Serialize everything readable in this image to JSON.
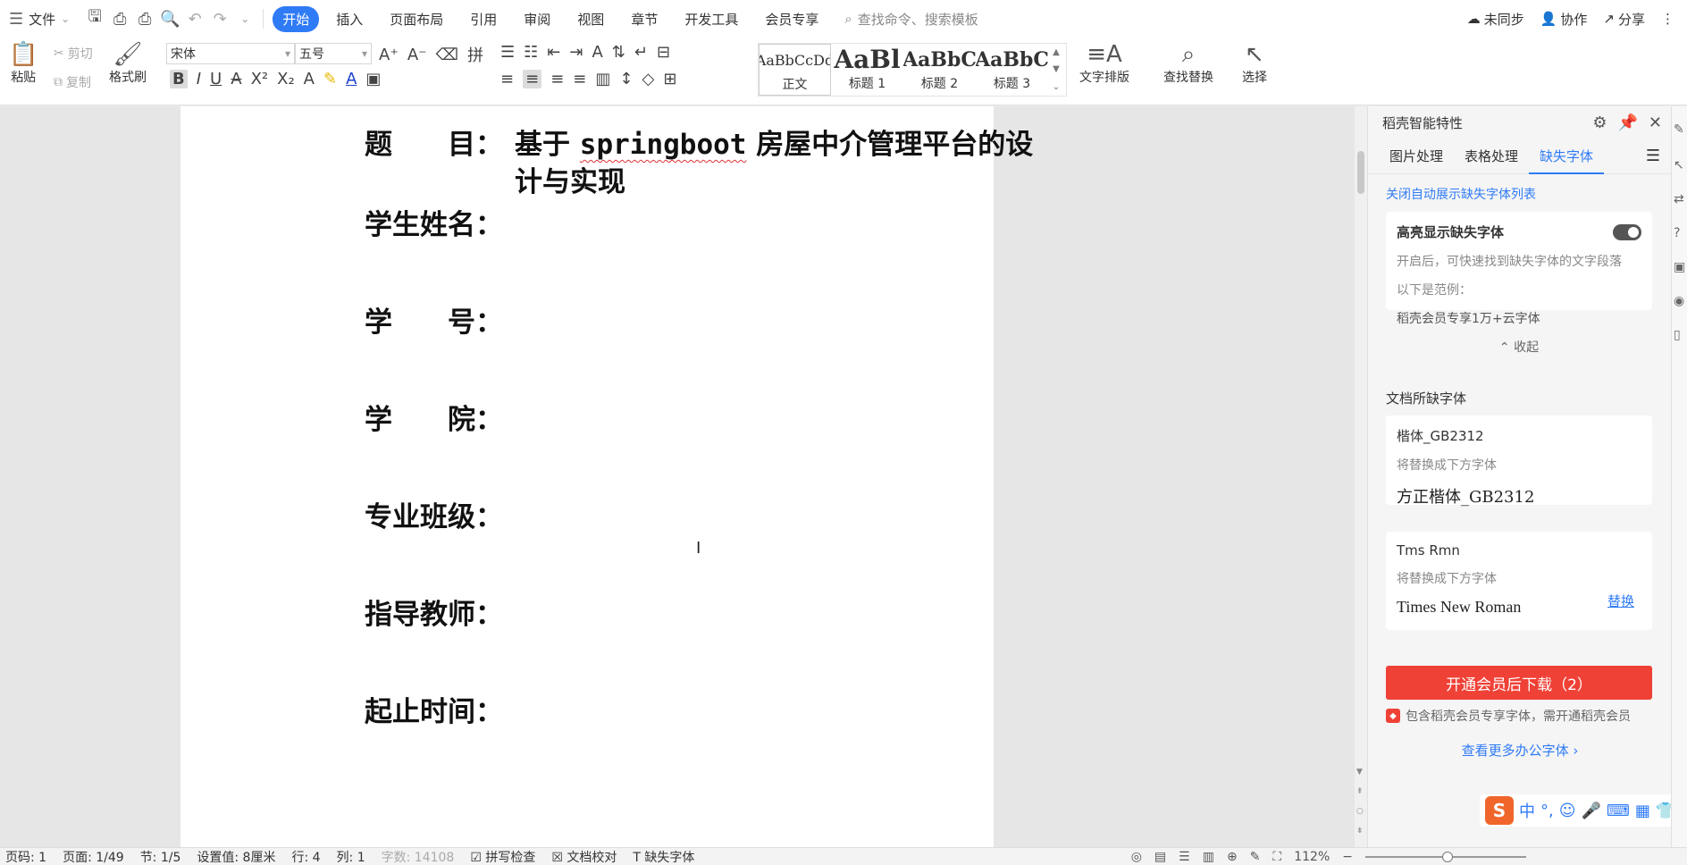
{
  "menubar": {
    "file_label": "文件",
    "tabs": [
      {
        "label": "开始",
        "active": true
      },
      {
        "label": "插入"
      },
      {
        "label": "页面布局"
      },
      {
        "label": "引用"
      },
      {
        "label": "审阅"
      },
      {
        "label": "视图"
      },
      {
        "label": "章节"
      },
      {
        "label": "开发工具"
      },
      {
        "label": "会员专享"
      }
    ],
    "search_placeholder": "查找命令、搜索模板",
    "right": {
      "sync": "未同步",
      "collab": "协作",
      "share": "分享"
    }
  },
  "ribbon": {
    "paste": "粘贴",
    "cut": "剪切",
    "copy": "复制",
    "format_painter": "格式刷",
    "font_family": "宋体",
    "font_size": "五号",
    "styles": [
      {
        "sample": "AaBbCcDd",
        "label": "正文"
      },
      {
        "sample": "AaBl",
        "label": "标题 1"
      },
      {
        "sample": "AaBbC",
        "label": "标题 2"
      },
      {
        "sample": "AaBbC",
        "label": "标题 3"
      }
    ],
    "text_layout": "文字排版",
    "find_replace": "查找替换",
    "select": "选择"
  },
  "document": {
    "title_label": "题　　目：",
    "title_prefix": "基于 ",
    "title_latin": "springboot",
    "title_rest": " 房屋中介管理平台的设计与实现",
    "fields": [
      "学生姓名：",
      "学　　号：",
      "学　　院：",
      "专业班级：",
      "指导教师：",
      "起止时间："
    ]
  },
  "panel": {
    "header": "稻壳智能特性",
    "tabs": [
      "图片处理",
      "表格处理",
      "缺失字体"
    ],
    "close_auto": "关闭自动展示缺失字体列表",
    "highlight_card": {
      "title": "高亮显示缺失字体",
      "desc": "开启后，可快速找到缺失字体的文字段落",
      "example_label": "以下是范例：",
      "example": "稻壳会员专享1万+云字体",
      "collapse": "收起"
    },
    "missing_label": "文档所缺字体",
    "fonts": [
      {
        "name": "楷体_GB2312",
        "replace_text": "将替换成下方字体",
        "sample": "方正楷体_GB2312"
      },
      {
        "name": "Tms Rmn",
        "replace_text": "将替换成下方字体",
        "sample": "Times New Roman",
        "action": "替换"
      }
    ],
    "download_btn": "开通会员后下载（2）",
    "member_note": "包含稻壳会员专享字体，需开通稻壳会员",
    "more_fonts": "查看更多办公字体"
  },
  "ime": {
    "logo": "S",
    "mode": "中"
  },
  "statusbar": {
    "page_num": "页码: 1",
    "page": "页面: 1/49",
    "section": "节: 1/5",
    "setting": "设置值: 8厘米",
    "row": "行: 4",
    "col": "列: 1",
    "wordcount": "字数: 14108",
    "spell": "拼写检查",
    "proof": "文档校对",
    "missing_font": "缺失字体",
    "zoom": "112%"
  }
}
